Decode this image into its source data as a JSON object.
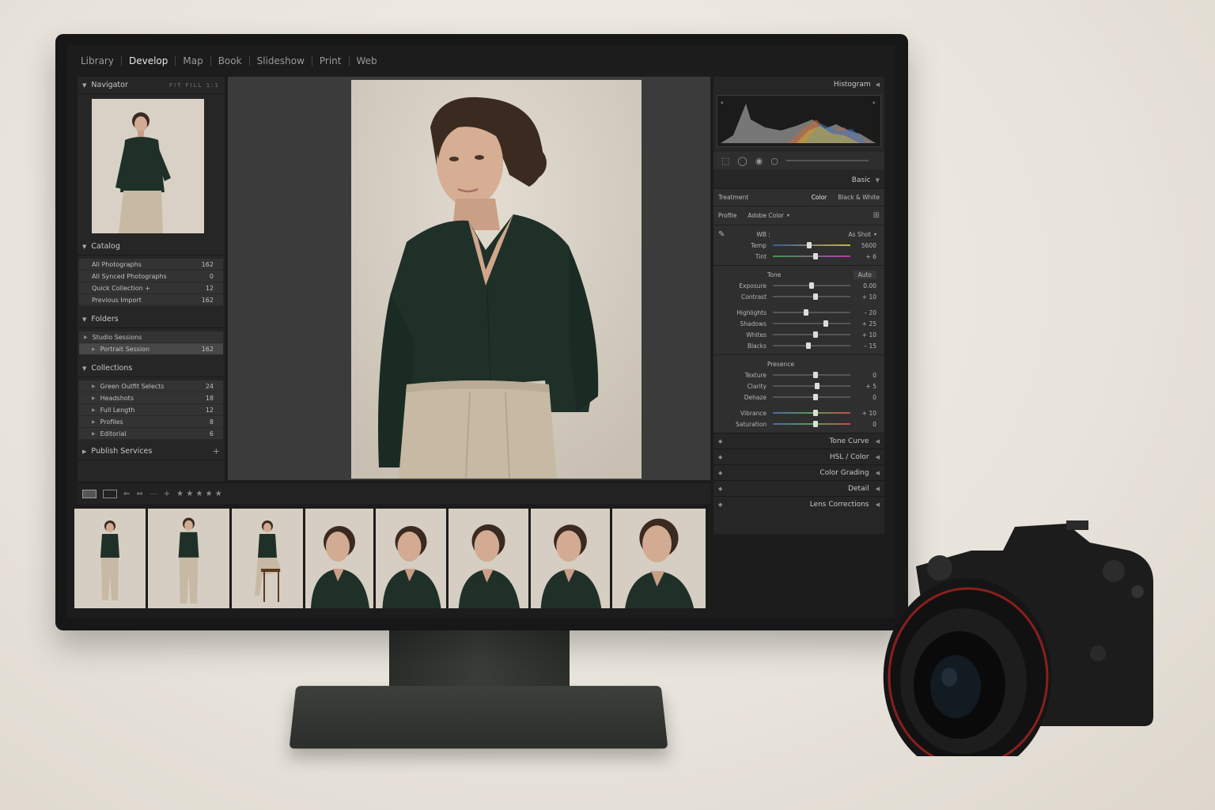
{
  "modules": [
    "Library",
    "Develop",
    "Map",
    "Book",
    "Slideshow",
    "Print",
    "Web"
  ],
  "active_module": "Develop",
  "left_panel": {
    "navigator_title": "Navigator",
    "navigator_controls": "FIT  FILL  1:1",
    "catalog": {
      "title": "Catalog",
      "items": [
        {
          "label": "All Photographs",
          "count": "162"
        },
        {
          "label": "All Synced Photographs",
          "count": "0"
        },
        {
          "label": "Quick Collection +",
          "count": "12"
        },
        {
          "label": "Previous Import",
          "count": "162"
        }
      ]
    },
    "folders": {
      "title": "Folders",
      "items": [
        {
          "label": "Studio Sessions",
          "count": ""
        },
        {
          "label": "Portrait Session",
          "count": "162"
        }
      ]
    },
    "collections": {
      "title": "Collections",
      "items": [
        {
          "label": "Green Outfit Selects",
          "count": "24"
        },
        {
          "label": "Headshots",
          "count": "18"
        },
        {
          "label": "Full Length",
          "count": "12"
        },
        {
          "label": "Profiles",
          "count": "8"
        },
        {
          "label": "Editorial",
          "count": "6"
        }
      ]
    },
    "publish_title": "Publish Services",
    "publish_add": "+"
  },
  "toolbar": {
    "stars": "★ ★ ★ ★ ★"
  },
  "right_panel": {
    "histogram_title": "Histogram",
    "basic_title": "Basic",
    "treatment_label": "Treatment",
    "treatment_color": "Color",
    "treatment_bw": "Black & White",
    "profile_label": "Profile",
    "profile_value": "Adobe Color",
    "wb_label": "WB :",
    "wb_value": "As Shot",
    "tone_label": "Tone",
    "tone_auto": "Auto",
    "presence_label": "Presence",
    "wb_sliders": [
      {
        "label": "Temp",
        "value": "5600",
        "pos": 0.47
      },
      {
        "label": "Tint",
        "value": "+ 6",
        "pos": 0.55
      }
    ],
    "tone_sliders": [
      {
        "label": "Exposure",
        "value": "0.00",
        "pos": 0.5
      },
      {
        "label": "Contrast",
        "value": "+ 10",
        "pos": 0.55
      }
    ],
    "tone_sliders2": [
      {
        "label": "Highlights",
        "value": "– 20",
        "pos": 0.43
      },
      {
        "label": "Shadows",
        "value": "+ 25",
        "pos": 0.69
      },
      {
        "label": "Whites",
        "value": "+ 10",
        "pos": 0.55
      },
      {
        "label": "Blacks",
        "value": "– 15",
        "pos": 0.46
      }
    ],
    "presence_sliders": [
      {
        "label": "Texture",
        "value": "0",
        "pos": 0.55
      },
      {
        "label": "Clarity",
        "value": "+ 5",
        "pos": 0.57
      },
      {
        "label": "Dehaze",
        "value": "0",
        "pos": 0.55
      }
    ],
    "presence_sliders2": [
      {
        "label": "Vibrance",
        "value": "+ 10",
        "pos": 0.55
      },
      {
        "label": "Saturation",
        "value": "0",
        "pos": 0.55
      }
    ],
    "collapsed_panels": [
      "Tone Curve",
      "HSL / Color",
      "Color Grading",
      "Detail",
      "Lens Corrections"
    ]
  },
  "filmstrip_count": 8,
  "colors": {
    "shirt": "#1f3028",
    "pants": "#c7b9a3",
    "backdrop": "#d9d1c5",
    "panel": "#262626"
  }
}
